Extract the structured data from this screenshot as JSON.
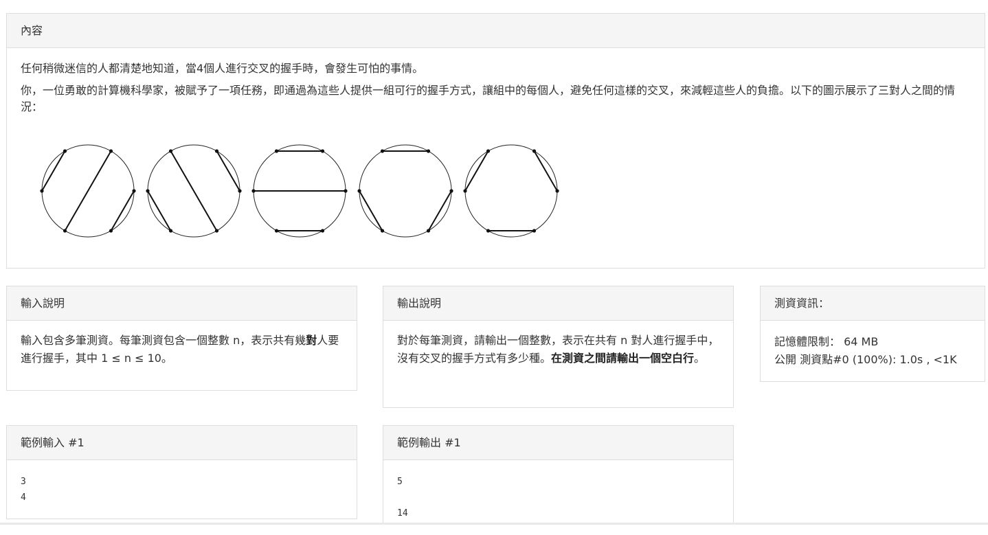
{
  "content": {
    "title": "內容",
    "para1": "任何稍微迷信的人都清楚地知道，當4個人進行交叉的握手時，會發生可怕的事情。",
    "para2": "你，一位勇敢的計算機科學家，被賦予了一項任務，即通過為這些人提供一組可行的握手方式，讓組中的每個人，避免任何這樣的交叉，來減輕這些人的負擔。以下的圖示展示了三對人之間的情況："
  },
  "input": {
    "title": "輸入說明",
    "text_a": "輸入包含多筆測資。每筆測資包含一個整數 n，表示共有幾",
    "text_b": "對",
    "text_c": "人要進行握手，其中 1 ≤ n ≤ 10。"
  },
  "output": {
    "title": "輸出說明",
    "text_a": "對於每筆測資，請輸出一個整數，表示在共有 n 對人進行握手中，沒有交叉的握手方式有多少種。",
    "text_b": "在測資之間請輸出一個空白行",
    "text_c": "。"
  },
  "testinfo": {
    "title": "測資資訊：",
    "memory": "記憶體限制： 64 MB",
    "public": "公開 測資點#0 (100%): 1.0s , <1K"
  },
  "sample_input": {
    "title": "範例輸入 #1",
    "content": "3\n4"
  },
  "sample_output": {
    "title": "範例輸出 #1",
    "content": "5\n\n14"
  }
}
